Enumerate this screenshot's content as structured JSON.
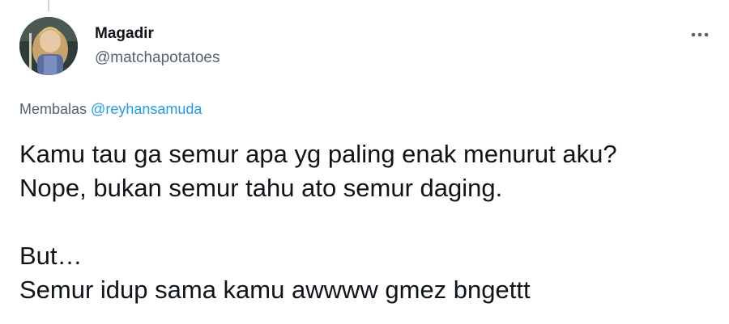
{
  "user": {
    "display_name": "Magadir",
    "handle": "@matchapotatoes"
  },
  "reply_context": {
    "prefix": "Membalas",
    "mention": "@reyhansamuda"
  },
  "tweet": {
    "lines": [
      "Kamu tau ga semur apa yg paling enak menurut aku?",
      "Nope, bukan semur tahu ato semur daging.",
      "",
      "But…",
      "Semur idup sama kamu awwww gmez bngettt"
    ]
  },
  "icons": {
    "avatar": "profile-avatar",
    "more": "more-horizontal-icon"
  },
  "colors": {
    "text_primary": "#0f1419",
    "text_secondary": "#536471",
    "accent": "#1d9bf0"
  }
}
